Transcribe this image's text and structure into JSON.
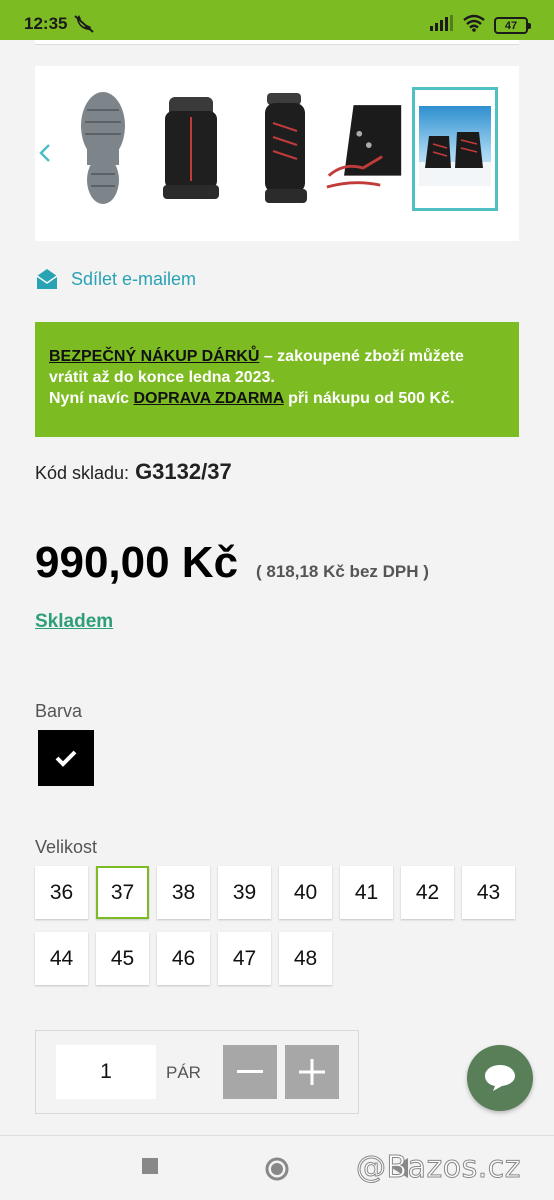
{
  "status_bar": {
    "time": "12:35",
    "battery": "47"
  },
  "colors": {
    "brand_green": "#7dbb23",
    "teal": "#29a3b4",
    "stock_green": "#2e9f79",
    "chat": "#587f57"
  },
  "gallery": {
    "thumbnails": [
      "boot-sole",
      "boot-back",
      "boot-side",
      "boot-laces",
      "boots-in-snow"
    ],
    "active_index": 4
  },
  "share": {
    "label": "Sdílet e-mailem"
  },
  "promo": {
    "link1": "BEZPEČNÝ NÁKUP DÁRKŮ",
    "text1": " – zakoupené zboží můžete vrátit až do konce ledna 2023.",
    "text2_prefix": "Nyní navíc ",
    "link2": "DOPRAVA ZDARMA",
    "text2_suffix": " při nákupu od 500 Kč."
  },
  "product": {
    "sku_label": "Kód skladu:",
    "sku": "G3132/37",
    "price": "990,00 Kč",
    "price_net": "( 818,18 Kč bez DPH )",
    "stock": "Skladem"
  },
  "color_label": "Barva",
  "size_label": "Velikost",
  "sizes": [
    "36",
    "37",
    "38",
    "39",
    "40",
    "41",
    "42",
    "43",
    "44",
    "45",
    "46",
    "47",
    "48"
  ],
  "selected_size": "37",
  "quantity": {
    "value": "1",
    "unit": "PÁR"
  },
  "watermark": "@Bazos.cz"
}
